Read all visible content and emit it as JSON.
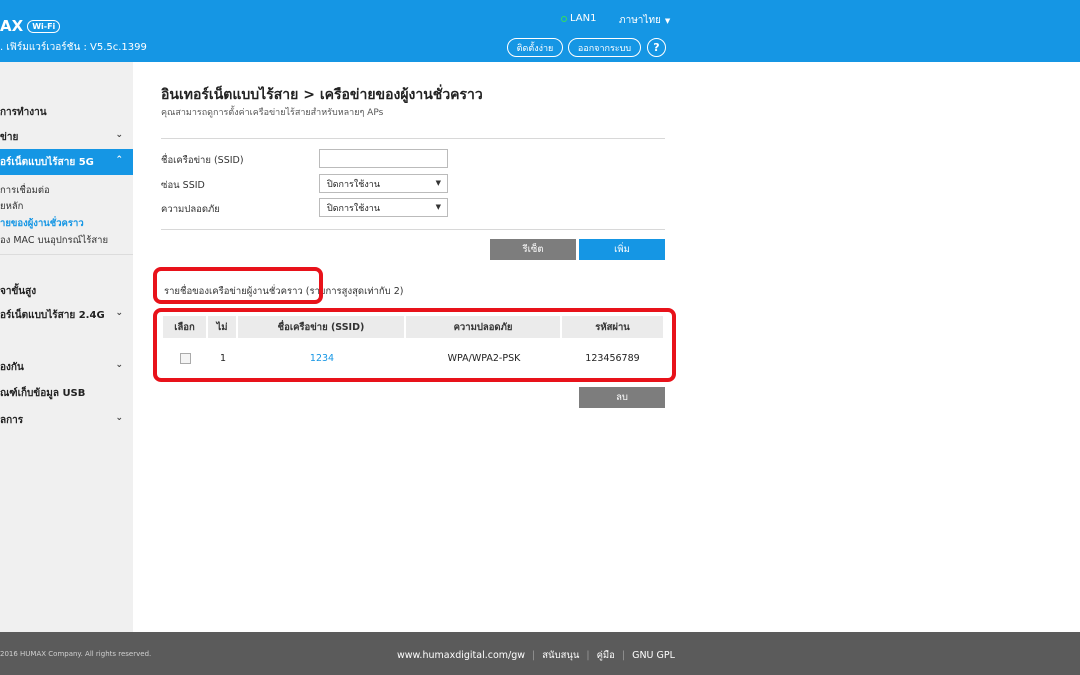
{
  "header": {
    "logo_text": "AX",
    "logo_badge": "Wi-Fi",
    "firmware": ". เฟิร์มแวร์เวอร์ชัน : V5.5c.1399",
    "lan_status": "LAN1",
    "language": "ภาษาไทย",
    "setup_button": "ติดตั้งง่าย",
    "logout_button": "ออกจากระบบ",
    "help_button": "?",
    "status_color": "#36e05a",
    "brand_color": "#1596e4"
  },
  "sidebar": {
    "items": [
      {
        "label": "การทำงาน"
      },
      {
        "label": "ข่าย"
      },
      {
        "label": "อร์เน็ตแบบไร้สาย 5G"
      },
      {
        "label": "จาขั้นสูง"
      },
      {
        "label": "อร์เน็ตแบบไร้สาย 2.4G"
      },
      {
        "label": "องกัน"
      },
      {
        "label": "ณฑ์เก็บข้อมูล USB"
      },
      {
        "label": "ลการ"
      }
    ],
    "subitems": [
      {
        "label": "การเชื่อมต่อ"
      },
      {
        "label": "ยหลัก"
      },
      {
        "label": "ายของผู้งานชั่วคราว"
      },
      {
        "label": "อง MAC บนอุปกรณ์ไร้สาย"
      }
    ]
  },
  "main": {
    "title": "อินเทอร์เน็ตแบบไร้สาย > เครือข่ายของผู้งานชั่วคราว",
    "subtitle": "คุณสามารถดูการตั้งค่าเครือข่ายไร้สายสำหรับหลายๆ APs",
    "form": {
      "ssid_label": "ชื่อเครือข่าย (SSID)",
      "ssid_value": "",
      "hide_label": "ซ่อน SSID",
      "hide_value": "ปิดการใช้งาน",
      "security_label": "ความปลอดภัย",
      "security_value": "ปิดการใช้งาน"
    },
    "reset_button": "รีเซ็ต",
    "add_button": "เพิ่ม",
    "list_caption": "รายชื่อของเครือข่ายผู้งานชั่วคราว  (รายการสูงสุดเท่ากับ 2)",
    "table": {
      "headers": [
        "เลือก",
        "ไม่",
        "ชื่อเครือข่าย (SSID)",
        "ความปลอดภัย",
        "รหัสผ่าน"
      ],
      "rows": [
        {
          "selected": false,
          "no": "1",
          "ssid": "1234",
          "security": "WPA/WPA2-PSK",
          "password": "123456789"
        }
      ]
    },
    "delete_button": "ลบ"
  },
  "footer": {
    "copyright": "2016 HUMAX Company. All rights reserved.",
    "links": [
      "www.humaxdigital.com/gw",
      "สนับสนุน",
      "คู่มือ",
      "GNU GPL"
    ]
  },
  "highlight_color": "#e8121a"
}
